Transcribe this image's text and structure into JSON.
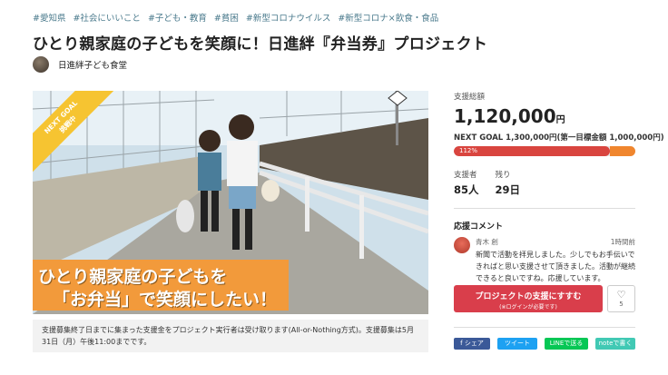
{
  "tags": [
    "#愛知県",
    "#社会にいいこと",
    "#子ども・教育",
    "#貧困",
    "#新型コロナウイルス",
    "#新型コロナ×飲食・食品"
  ],
  "project": {
    "title": "ひとり親家庭の子どもを笑顔に！日進絆『弁当券』プロジェクト",
    "owner": "日進絆子ども食堂"
  },
  "hero": {
    "ribbon": "NEXT GOAL\n挑戦中",
    "banner_line1": "ひとり親家庭の子どもを",
    "banner_line2": "「お弁当」で笑顔にしたい！"
  },
  "notice": "支援募集終了日までに集まった支援金をプロジェクト実行者は受け取ります(All-or-Nothing方式)。支援募集は5月31日（月）午後11:00までです。",
  "stats": {
    "total_label": "支援総額",
    "total_amount": "1,120,000",
    "total_unit": "円",
    "next_goal": "NEXT GOAL 1,300,000円(第一目標金額 1,000,000円)",
    "progress_text": "112%",
    "progress_fraction": 0.86,
    "next_fraction": 0.14,
    "supporters_label": "支援者",
    "supporters_value": "85人",
    "remaining_label": "残り",
    "remaining_value": "29日"
  },
  "comments": {
    "heading": "応援コメント",
    "items": [
      {
        "author": "青木 創",
        "time": "1時間前",
        "text": "新聞で活動を拝見しました。少しでもお手伝いできればと思い支援させて頂きました。活動が継続できると良いですね。応援しています。"
      }
    ]
  },
  "actions": {
    "support_label": "プロジェクトの支援にすすむ",
    "support_sub": "(※ログインが必要です)",
    "like_icon": "♡",
    "like_count": "5"
  },
  "share": {
    "facebook": "f シェア",
    "twitter": "ツイート",
    "line": "LINEで送る",
    "note": "noteで書く"
  },
  "colors": {
    "accent": "#d93e4b",
    "progress": "#d9453f",
    "next_goal": "#f0862e",
    "ribbon": "#f6c431",
    "banner": "#f29a3b"
  }
}
